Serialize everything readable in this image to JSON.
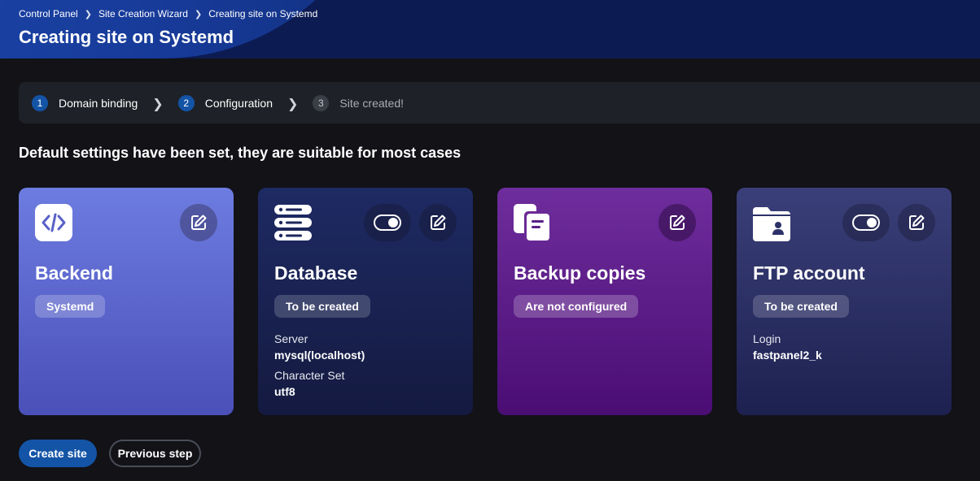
{
  "header": {
    "breadcrumb": [
      "Control Panel",
      "Site Creation Wizard",
      "Creating site on Systemd"
    ],
    "title": "Creating site on Systemd"
  },
  "steps": [
    {
      "number": "1",
      "label": "Domain binding",
      "state": "done"
    },
    {
      "number": "2",
      "label": "Configuration",
      "state": "active"
    },
    {
      "number": "3",
      "label": "Site created!",
      "state": "inactive"
    }
  ],
  "subtitle": "Default settings have been set, they are suitable for most cases",
  "cards": {
    "backend": {
      "title": "Backend",
      "badge": "Systemd",
      "icon": "code-icon"
    },
    "database": {
      "title": "Database",
      "badge": "To be created",
      "icon": "server-stack-icon",
      "toggle_on": true,
      "server_label": "Server",
      "server_value": "mysql(localhost)",
      "charset_label": "Character Set",
      "charset_value": "utf8"
    },
    "backup": {
      "title": "Backup copies",
      "badge": "Are not configured",
      "icon": "documents-icon"
    },
    "ftp": {
      "title": "FTP account",
      "badge": "To be created",
      "icon": "folder-user-icon",
      "toggle_on": true,
      "login_label": "Login",
      "login_value": "fastpanel2_k"
    }
  },
  "actions": {
    "create_label": "Create site",
    "previous_label": "Previous step"
  },
  "colors": {
    "accent": "#1454a6",
    "background": "#121217",
    "header": "#0c1b52"
  }
}
